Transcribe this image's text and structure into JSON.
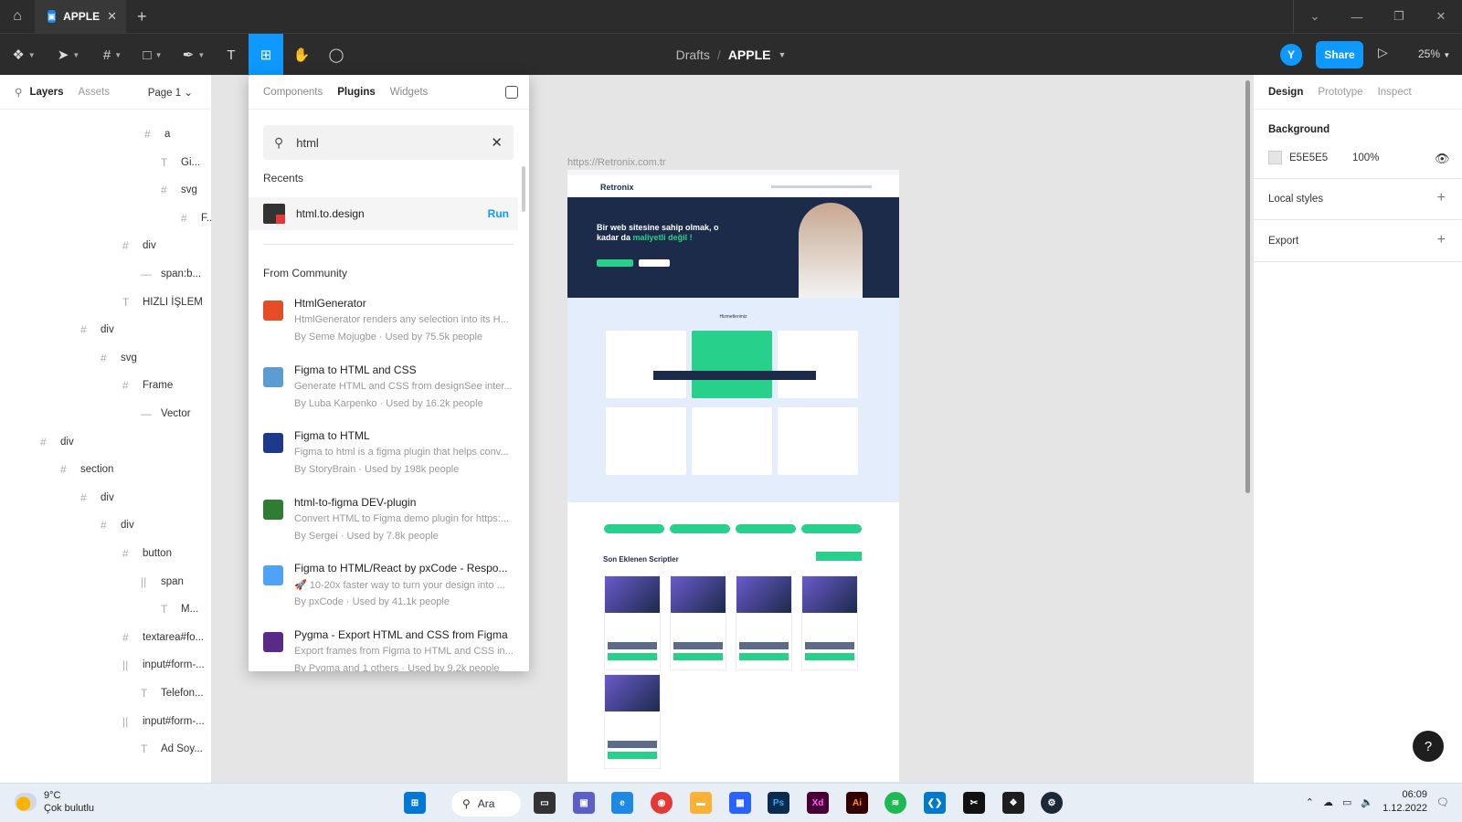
{
  "titlebar": {
    "tab_title": "APPLE",
    "tab_close": "✕",
    "new_tab": "+",
    "home": "⌂",
    "window_buttons": {
      "dropdown": "⌄",
      "minimize": "—",
      "restore": "❐",
      "close": "✕"
    }
  },
  "toolbar": {
    "breadcrumb_drafts": "Drafts",
    "breadcrumb_sep": "/",
    "file_name": "APPLE",
    "avatar_initial": "Y",
    "share_label": "Share",
    "zoom": "25%",
    "play": "▷"
  },
  "left_panel": {
    "tab_layers": "Layers",
    "tab_assets": "Assets",
    "page": "Page 1 ⌄",
    "layers": [
      {
        "icon": "#",
        "name": "a"
      },
      {
        "icon": "T",
        "name": "Gi..."
      },
      {
        "icon": "#",
        "name": "svg"
      },
      {
        "icon": "#",
        "name": "F..."
      },
      {
        "icon": "#",
        "name": "div"
      },
      {
        "icon": "—",
        "name": "span:b..."
      },
      {
        "icon": "T",
        "name": "HIZLI İŞLEM"
      },
      {
        "icon": "#",
        "name": "div"
      },
      {
        "icon": "#",
        "name": "svg"
      },
      {
        "icon": "#",
        "name": "Frame"
      },
      {
        "icon": "—",
        "name": "Vector"
      },
      {
        "icon": "#",
        "name": "div"
      },
      {
        "icon": "#",
        "name": "section"
      },
      {
        "icon": "#",
        "name": "div"
      },
      {
        "icon": "#",
        "name": "div"
      },
      {
        "icon": "#",
        "name": "button"
      },
      {
        "icon": "||",
        "name": "span"
      },
      {
        "icon": "T",
        "name": "M..."
      },
      {
        "icon": "#",
        "name": "textarea#fo..."
      },
      {
        "icon": "||",
        "name": "input#form-..."
      },
      {
        "icon": "T",
        "name": "Telefon..."
      },
      {
        "icon": "||",
        "name": "input#form-..."
      },
      {
        "icon": "T",
        "name": "Ad Soy..."
      }
    ]
  },
  "plugins_panel": {
    "tabs": [
      "Components",
      "Plugins",
      "Widgets"
    ],
    "search_value": "html",
    "recents_label": "Recents",
    "recent": {
      "name": "html.to.design",
      "run": "Run"
    },
    "community_label": "From Community",
    "items": [
      {
        "title": "HtmlGenerator",
        "desc": "HtmlGenerator renders any selection into its H...",
        "by": "By Seme Mojugbe · Used by 75.5k people",
        "icon": "html5-icon",
        "color": "#e44d26"
      },
      {
        "title": "Figma to HTML and CSS",
        "desc": "Generate HTML and CSS from designSee inter...",
        "by": "By Luba Karpenko · Used by 16.2k people",
        "icon": "code-icon",
        "color": "#5c9ccf"
      },
      {
        "title": "Figma to HTML",
        "desc": "Figma to html is a figma plugin that helps conv...",
        "by": "By StoryBrain · Used by 198k people",
        "icon": "storybrain-icon",
        "color": "#1d3a8a"
      },
      {
        "title": "html-to-figma DEV-plugin",
        "desc": "Convert HTML to Figma demo plugin for https:...",
        "by": "By Sergei · Used by 7.8k people",
        "icon": "html-figma-icon",
        "color": "#2e7d32"
      },
      {
        "title": "Figma to HTML/React by pxCode - Respo...",
        "desc": "🚀 10-20x faster way to turn your design into ...",
        "by": "By pxCode · Used by 41.1k people",
        "icon": "px-icon",
        "color": "#4fa3f7"
      },
      {
        "title": "Pygma - Export HTML and CSS from Figma",
        "desc": "Export frames from Figma to HTML and CSS in...",
        "by": "By Pygma and 1 others · Used by 9.2k people",
        "icon": "pygma-icon",
        "color": "#5b2a86"
      }
    ]
  },
  "canvas": {
    "frame_url": "https://Retronix.com.tr",
    "site_logo": "Retronix",
    "hero_text": "Bir web sitesine sahip olmak, o kadar da",
    "hero_highlight": "maliyetli değil !",
    "services_title": "Hizmetlerimiz",
    "scripts_title": "Son Eklenen Scriptler"
  },
  "right_panel": {
    "tabs": [
      "Design",
      "Prototype",
      "Inspect"
    ],
    "background_label": "Background",
    "background_hex": "E5E5E5",
    "background_opacity": "100%",
    "local_styles": "Local styles",
    "export": "Export"
  },
  "taskbar": {
    "weather_temp": "9°C",
    "weather_desc": "Çok bulutlu",
    "search_label": "Ara",
    "time": "06:09",
    "date": "1.12.2022"
  },
  "colors": {
    "accent": "#0d99ff",
    "toolbar_bg": "#2c2c2c",
    "site_green": "#27d18b",
    "site_navy": "#1c2b4a"
  }
}
